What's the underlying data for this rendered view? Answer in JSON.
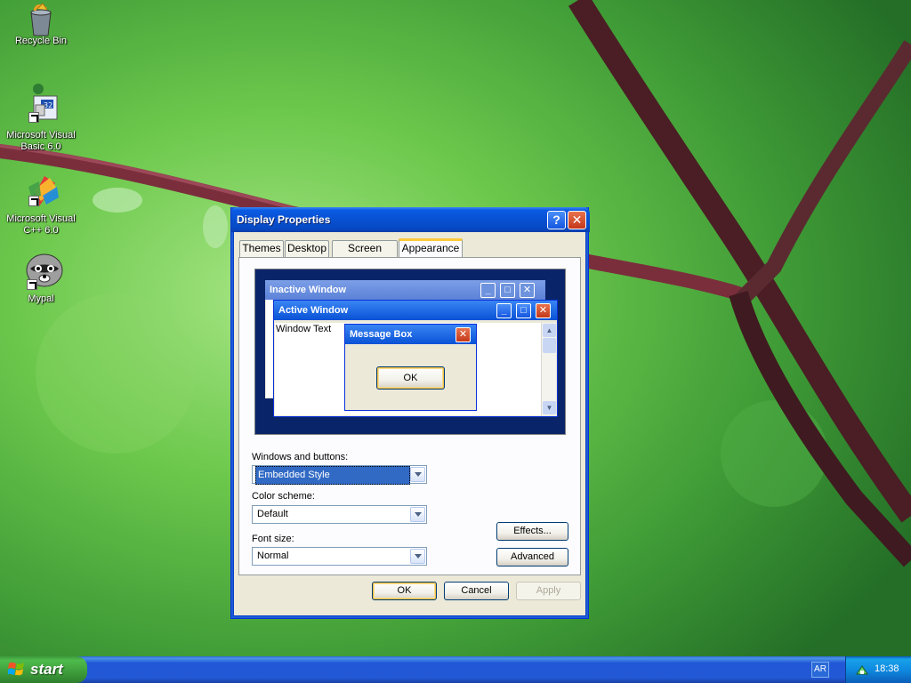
{
  "desktop": {
    "icons": [
      {
        "label": "Recycle Bin",
        "icon": "recycle-bin-icon"
      },
      {
        "label": "Microsoft Visual Basic 6.0",
        "icon": "visual-basic-icon"
      },
      {
        "label": "Microsoft Visual C++ 6.0",
        "icon": "visual-cpp-icon"
      },
      {
        "label": "Mypal",
        "icon": "mypal-icon"
      }
    ]
  },
  "dialog": {
    "title": "Display Properties",
    "help_button": "?",
    "close_button": "✕",
    "tabs": [
      "Themes",
      "Desktop",
      "Screen Saver",
      "Appearance"
    ],
    "active_tab": "Appearance",
    "preview": {
      "inactive_title": "Inactive Window",
      "active_title": "Active Window",
      "window_text": "Window Text",
      "message_title": "Message Box",
      "message_ok": "OK"
    },
    "windows_buttons_label": "Windows and buttons:",
    "windows_buttons_value": "Embedded Style",
    "color_scheme_label": "Color scheme:",
    "color_scheme_value": "Default",
    "font_size_label": "Font size:",
    "font_size_value": "Normal",
    "effects_button": "Effects...",
    "advanced_button": "Advanced",
    "ok_button": "OK",
    "cancel_button": "Cancel",
    "apply_button": "Apply"
  },
  "taskbar": {
    "start_label": "start",
    "language": "AR",
    "clock": "18:38"
  }
}
